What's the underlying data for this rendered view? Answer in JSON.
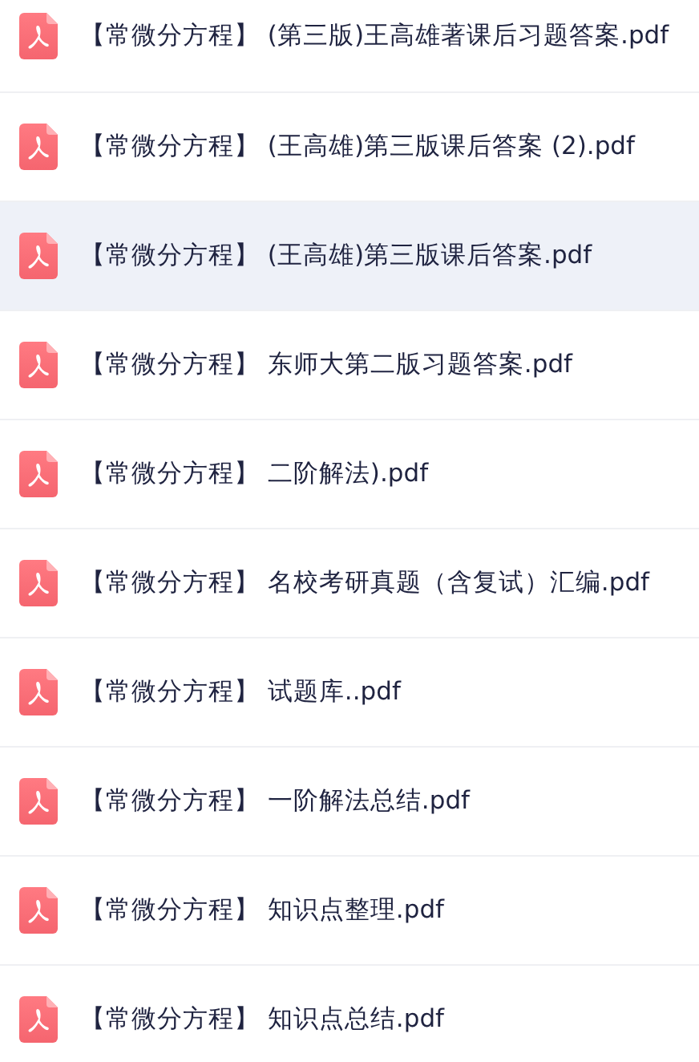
{
  "files": [
    {
      "name": "【常微分方程】 (第三版)王高雄著课后习题答案.pdf",
      "selected": false
    },
    {
      "name": "【常微分方程】 (王高雄)第三版课后答案 (2).pdf",
      "selected": false
    },
    {
      "name": "【常微分方程】 (王高雄)第三版课后答案.pdf",
      "selected": true
    },
    {
      "name": "【常微分方程】 东师大第二版习题答案.pdf",
      "selected": false
    },
    {
      "name": "【常微分方程】 二阶解法).pdf",
      "selected": false
    },
    {
      "name": "【常微分方程】 名校考研真题（含复试）汇编.pdf",
      "selected": false
    },
    {
      "name": "【常微分方程】 试题库..pdf",
      "selected": false
    },
    {
      "name": "【常微分方程】 一阶解法总结.pdf",
      "selected": false
    },
    {
      "name": "【常微分方程】 知识点整理.pdf",
      "selected": false
    },
    {
      "name": "【常微分方程】 知识点总结.pdf",
      "selected": false
    }
  ]
}
